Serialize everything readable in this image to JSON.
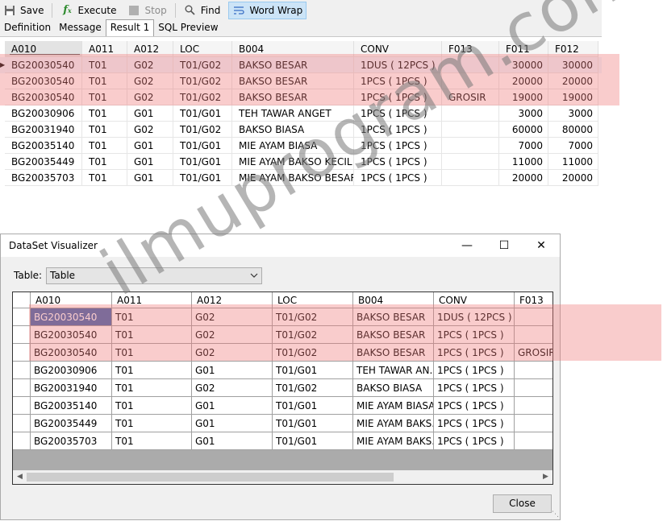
{
  "toolbar": {
    "save": "Save",
    "execute": "Execute",
    "stop": "Stop",
    "find": "Find",
    "word_wrap": "Word Wrap"
  },
  "tabs": [
    "Definition",
    "Message",
    "Result 1",
    "SQL Preview"
  ],
  "result_grid": {
    "columns": [
      "A010",
      "A011",
      "A012",
      "LOC",
      "B004",
      "CONV",
      "F013",
      "F011",
      "F012"
    ],
    "rows": [
      [
        "BG20030540",
        "T01",
        "G02",
        "T01/G02",
        "BAKSO BESAR",
        "1DUS ( 12PCS )",
        "",
        "30000",
        "30000"
      ],
      [
        "BG20030540",
        "T01",
        "G02",
        "T01/G02",
        "BAKSO BESAR",
        "1PCS ( 1PCS )",
        "",
        "20000",
        "20000"
      ],
      [
        "BG20030540",
        "T01",
        "G02",
        "T01/G02",
        "BAKSO BESAR",
        "1PCS ( 1PCS )",
        "GROSIR",
        "19000",
        "19000"
      ],
      [
        "BG20030906",
        "T01",
        "G01",
        "T01/G01",
        "TEH TAWAR ANGET",
        "1PCS ( 1PCS )",
        "",
        "3000",
        "3000"
      ],
      [
        "BG20031940",
        "T01",
        "G02",
        "T01/G02",
        "BAKSO BIASA",
        "1PCS ( 1PCS )",
        "",
        "60000",
        "80000"
      ],
      [
        "BG20035140",
        "T01",
        "G01",
        "T01/G01",
        "MIE AYAM BIASA",
        "1PCS ( 1PCS )",
        "",
        "7000",
        "7000"
      ],
      [
        "BG20035449",
        "T01",
        "G01",
        "T01/G01",
        "MIE AYAM BAKSO KECIL",
        "1PCS ( 1PCS )",
        "",
        "11000",
        "11000"
      ],
      [
        "BG20035703",
        "T01",
        "G01",
        "T01/G01",
        "MIE AYAM BAKSO BESAR",
        "1PCS ( 1PCS )",
        "",
        "20000",
        "20000"
      ]
    ]
  },
  "dialog": {
    "title": "DataSet Visualizer",
    "minimize_icon": "—",
    "maximize_icon": "☐",
    "close_icon": "✕",
    "table_label": "Table:",
    "table_value": "Table",
    "close_button": "Close",
    "columns": [
      "A010",
      "A011",
      "A012",
      "LOC",
      "B004",
      "CONV",
      "F013"
    ],
    "rows": [
      [
        "BG20030540",
        "T01",
        "G02",
        "T01/G02",
        "BAKSO BESAR",
        "1DUS ( 12PCS )",
        ""
      ],
      [
        "BG20030540",
        "T01",
        "G02",
        "T01/G02",
        "BAKSO BESAR",
        "1PCS ( 1PCS )",
        ""
      ],
      [
        "BG20030540",
        "T01",
        "G02",
        "T01/G02",
        "BAKSO BESAR",
        "1PCS ( 1PCS )",
        "GROSIR"
      ],
      [
        "BG20030906",
        "T01",
        "G01",
        "T01/G01",
        "TEH TAWAR AN...",
        "1PCS ( 1PCS )",
        ""
      ],
      [
        "BG20031940",
        "T01",
        "G02",
        "T01/G02",
        "BAKSO BIASA",
        "1PCS ( 1PCS )",
        ""
      ],
      [
        "BG20035140",
        "T01",
        "G01",
        "T01/G01",
        "MIE AYAM BIASA",
        "1PCS ( 1PCS )",
        ""
      ],
      [
        "BG20035449",
        "T01",
        "G01",
        "T01/G01",
        "MIE AYAM BAKS...",
        "1PCS ( 1PCS )",
        ""
      ],
      [
        "BG20035703",
        "T01",
        "G01",
        "T01/G01",
        "MIE AYAM BAKS...",
        "1PCS ( 1PCS )",
        ""
      ]
    ]
  },
  "watermark": "ilmuprogram.com",
  "colors": {
    "highlight": "#f07878",
    "selection": "#3b64ad",
    "active_tab_border": "#99c9ef"
  }
}
